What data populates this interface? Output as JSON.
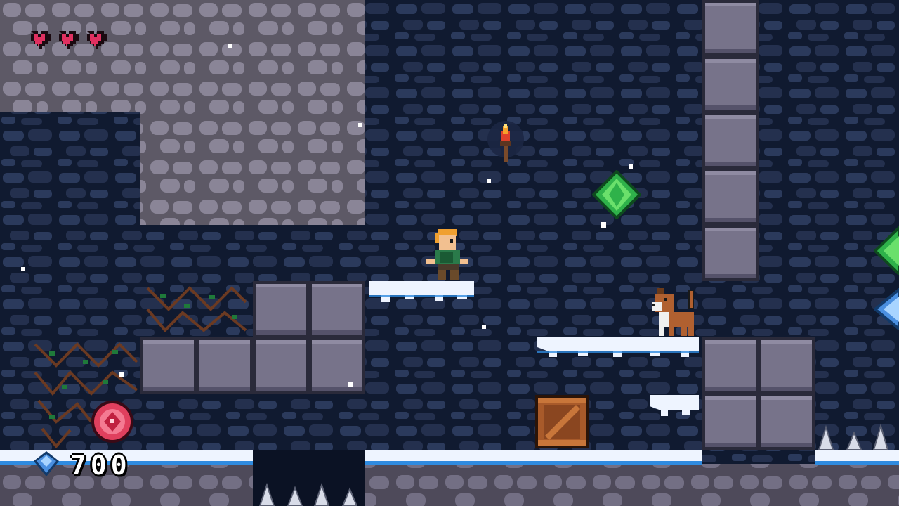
{
  "hud": {
    "hearts": 3,
    "score": "700",
    "score_icon": "blue-gem-icon"
  },
  "colors": {
    "cave_dark": "#101a30",
    "cave_light": "#6f6a78",
    "stone": "#77738a",
    "ice": "#eef4ff",
    "ice_edge": "#2f8be0",
    "heart": "#e03060"
  },
  "entities": {
    "player": "player-character",
    "enemy": "brown-dog-enemy",
    "pickups": [
      "green-gem",
      "green-gem-edge",
      "blue-gem-edge",
      "red-ruby"
    ],
    "props": [
      "wall-torch",
      "wooden-crate",
      "floor-spikes",
      "thorny-vines"
    ]
  }
}
